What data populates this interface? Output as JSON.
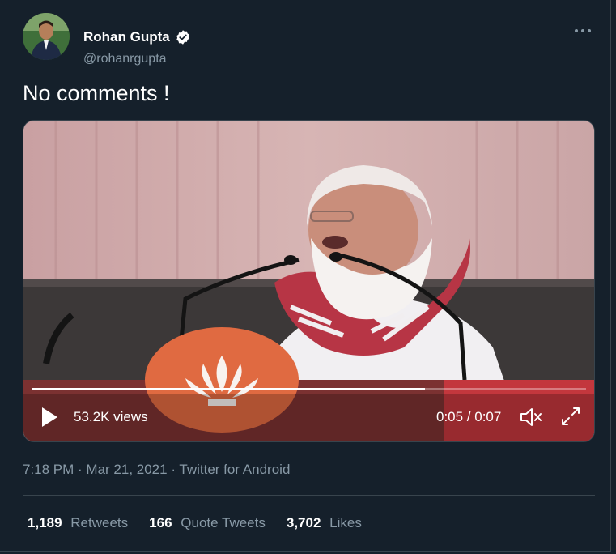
{
  "author": {
    "name": "Rohan Gupta",
    "handle": "@rohanrgupta",
    "verified": true
  },
  "tweet": {
    "text": "No comments !"
  },
  "video": {
    "views": "53.2K views",
    "time": "0:05 / 0:07",
    "progress": 0.71
  },
  "meta": {
    "timestamp": "7:18 PM · Mar 21, 2021 · Twitter for Android"
  },
  "stats": [
    {
      "count": "1,189",
      "label": "Retweets"
    },
    {
      "count": "166",
      "label": "Quote Tweets"
    },
    {
      "count": "3,702",
      "label": "Likes"
    }
  ],
  "colors": {
    "background": "#15202b",
    "secondary_text": "#8899a6",
    "divider": "#38444d",
    "verified": "#ffffff"
  }
}
